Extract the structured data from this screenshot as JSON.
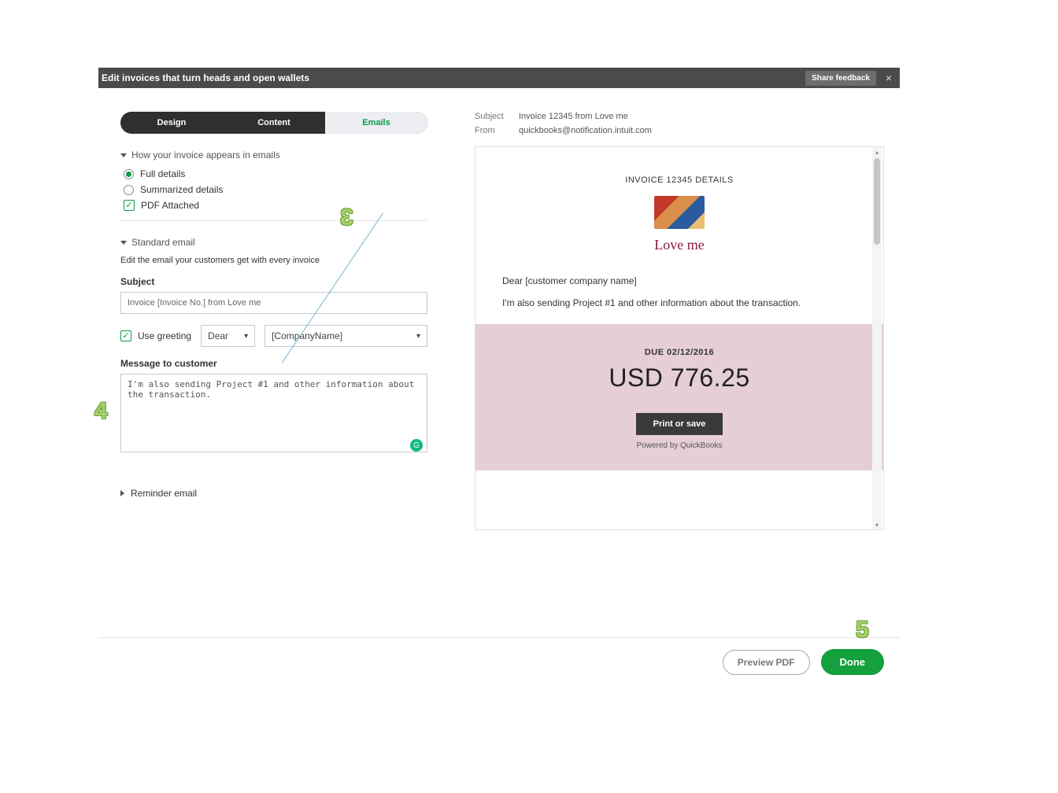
{
  "topbar": {
    "title": "Edit invoices that turn heads and open wallets",
    "feedback": "Share feedback",
    "close": "×"
  },
  "tabs": {
    "design": "Design",
    "content": "Content",
    "emails": "Emails"
  },
  "sections": {
    "appears": "How your invoice appears in emails",
    "standard": "Standard email",
    "standard_help": "Edit the email your customers get with every invoice",
    "reminder": "Reminder email"
  },
  "options": {
    "full_details": "Full details",
    "summarized": "Summarized details",
    "pdf_attached": "PDF Attached"
  },
  "fields": {
    "subject_label": "Subject",
    "subject_value": "Invoice [Invoice No.] from Love me",
    "use_greeting": "Use greeting",
    "greeting_word": "Dear",
    "company_token": "[CompanyName]",
    "message_label": "Message to customer",
    "message_value": "I'm also sending Project #1 and other information about the transaction."
  },
  "preview_meta": {
    "subject_label": "Subject",
    "subject_value": "Invoice 12345 from Love me",
    "from_label": "From",
    "from_value": "quickbooks@notification.intuit.com"
  },
  "preview": {
    "details_title": "INVOICE 12345 DETAILS",
    "company": "Love me",
    "greeting": "Dear [customer company name]",
    "message": "I'm also sending Project #1 and other information about the transaction.",
    "due": "DUE 02/12/2016",
    "amount": "USD 776.25",
    "print": "Print or save",
    "powered": "Powered by QuickBooks"
  },
  "footer": {
    "preview": "Preview PDF",
    "done": "Done"
  },
  "annotations": {
    "n3": "3",
    "n4": "4",
    "n5": "5"
  }
}
